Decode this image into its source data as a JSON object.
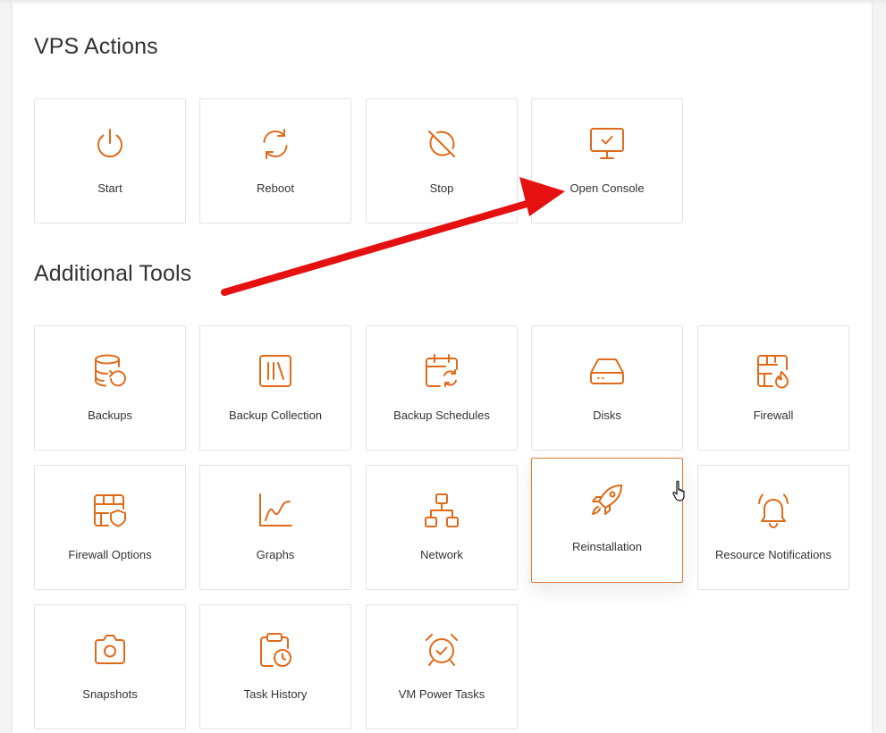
{
  "sections": {
    "actions_title": "VPS Actions",
    "tools_title": "Additional Tools"
  },
  "actions": [
    {
      "label": "Start",
      "icon": "power-icon"
    },
    {
      "label": "Reboot",
      "icon": "reboot-icon"
    },
    {
      "label": "Stop",
      "icon": "stop-icon"
    },
    {
      "label": "Open Console",
      "icon": "monitor-check-icon"
    }
  ],
  "tools": [
    {
      "label": "Backups",
      "icon": "database-restore-icon"
    },
    {
      "label": "Backup Collection",
      "icon": "library-icon"
    },
    {
      "label": "Backup Schedules",
      "icon": "calendar-sync-icon"
    },
    {
      "label": "Disks",
      "icon": "hard-drive-icon"
    },
    {
      "label": "Firewall",
      "icon": "firewall-flame-icon"
    },
    {
      "label": "Firewall Options",
      "icon": "firewall-shield-icon"
    },
    {
      "label": "Graphs",
      "icon": "line-chart-icon"
    },
    {
      "label": "Network",
      "icon": "network-icon"
    },
    {
      "label": "Reinstallation",
      "icon": "rocket-icon"
    },
    {
      "label": "Resource Notifications",
      "icon": "bell-ring-icon"
    },
    {
      "label": "Snapshots",
      "icon": "camera-icon"
    },
    {
      "label": "Task History",
      "icon": "clipboard-clock-icon"
    },
    {
      "label": "VM Power Tasks",
      "icon": "alarm-clock-check-icon"
    }
  ],
  "colors": {
    "accent": "#e06a1a",
    "active_border": "#e07a2e",
    "annotation_arrow": "#e51010"
  }
}
